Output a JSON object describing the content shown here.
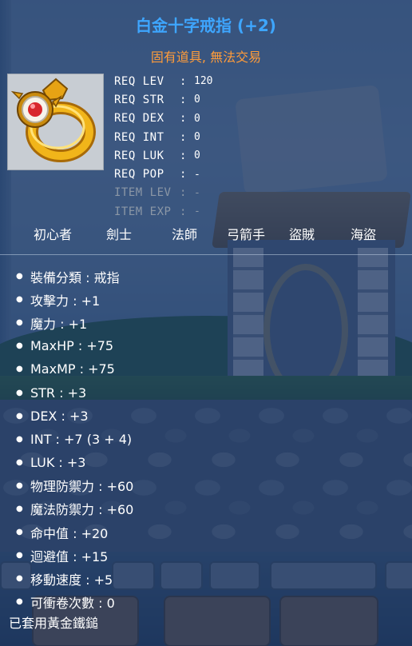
{
  "item": {
    "name": "白金十字戒指 (+2)",
    "subtitle": "固有道具, 無法交易",
    "icon": "gold-ring-icon"
  },
  "requirements": [
    {
      "label": "REQ LEV",
      "value": "120",
      "dim": false
    },
    {
      "label": "REQ STR",
      "value": "0",
      "dim": false
    },
    {
      "label": "REQ DEX",
      "value": "0",
      "dim": false
    },
    {
      "label": "REQ INT",
      "value": "0",
      "dim": false
    },
    {
      "label": "REQ LUK",
      "value": "0",
      "dim": false
    },
    {
      "label": "REQ POP",
      "value": "-",
      "dim": false
    },
    {
      "label": "ITEM LEV",
      "value": "-",
      "dim": true
    },
    {
      "label": "ITEM EXP",
      "value": "-",
      "dim": true
    }
  ],
  "jobs": [
    "初心者",
    "劍士",
    "法師",
    "弓箭手",
    "盜賊",
    "海盜"
  ],
  "stats": [
    "裝備分類 : 戒指",
    "攻擊力 : +1",
    "魔力 : +1",
    "MaxHP : +75",
    "MaxMP : +75",
    "STR : +3",
    "DEX : +3",
    "INT : +7 (3 + 4)",
    "LUK : +3",
    "物理防禦力 : +60",
    "魔法防禦力 : +60",
    "命中值 : +20",
    "迴避值 : +15",
    "移動速度 : +5",
    "可衝卷次數 : 0"
  ],
  "footer": "已套用黃金鐵鎚",
  "colors": {
    "title": "#3ea6ff",
    "subtitle": "#ff9c3a",
    "text": "#ffffff",
    "dim": "#8b97a6"
  }
}
